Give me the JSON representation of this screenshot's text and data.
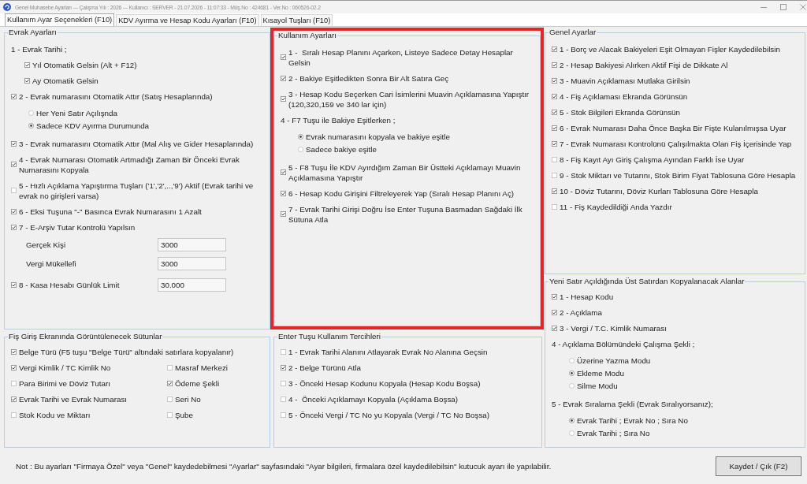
{
  "window": {
    "title": "Genel Muhasebe Ayarları --- Çalışma Yılı : 2026 --- Kullanıcı : SERVER - 21.07.2026 - 11:07:33 - Müş.No : 424681 - Ver.No : 060526-02.2"
  },
  "tabs": [
    {
      "label": "Kullanım Ayar Seçenekleri (F10)",
      "selected": true
    },
    {
      "label": "KDV Ayırma ve Hesap Kodu Ayarları (F10)",
      "selected": false
    },
    {
      "label": "Kısayol Tuşları (F10)",
      "selected": false
    }
  ],
  "columns": [
    {
      "panels": [
        {
          "title": "Evrak Ayarları",
          "highlighted": false,
          "items": [
            {
              "kind": "heading",
              "label": "1 - Evrak Tarihi ;",
              "children": [
                {
                  "kind": "check",
                  "label": "Yıl Otomatik Gelsin (Alt + F12)",
                  "checked": true
                },
                {
                  "kind": "check",
                  "label": "Ay Otomatik Gelsin",
                  "checked": true
                }
              ]
            },
            {
              "kind": "check",
              "label": "2 - Evrak numarasını Otomatik Attır (Satış Hesaplarında)",
              "checked": true,
              "children": [
                {
                  "kind": "radio",
                  "label": "Her Yeni Satır Açılışnda",
                  "selected": false
                },
                {
                  "kind": "radio",
                  "label": "Sadece KDV Ayırma Durumunda",
                  "selected": true
                }
              ]
            },
            {
              "kind": "check",
              "label": "3 - Evrak numarasını Otomatik Attır (Mal Alış ve Gider Hesaplarında)",
              "checked": true
            },
            {
              "kind": "check",
              "label": "4 - Evrak Numarası Otomatik Artmadığı Zaman Bir Önceki Evrak Numarasını Kopyala",
              "checked": true
            },
            {
              "kind": "check",
              "label": "5 - Hızlı Açıklama Yapıştırma Tuşları ('1','2',..,'9') Aktif (Evrak tarihi ve evrak no girişleri varsa)",
              "checked": false
            },
            {
              "kind": "check",
              "label": "6 - Eksi Tuşuna \"-\" Basınca Evrak Numarasını 1 Azalt",
              "checked": true
            },
            {
              "kind": "check",
              "label": "7 - E-Arşiv Tutar Kontrolü Yapılsın",
              "checked": true,
              "children": [
                {
                  "kind": "field",
                  "label": "Gerçek Kişi",
                  "value": "3000"
                },
                {
                  "kind": "field",
                  "label": "Vergi Mükellefi",
                  "value": "3000"
                }
              ]
            },
            {
              "kind": "check",
              "label": "8 - Kasa Hesabı Günlük Limit",
              "checked": true,
              "value": "30.000"
            }
          ]
        },
        {
          "title": "Fiş Giriş Ekranında Görüntülenecek Sütunlar",
          "highlighted": false,
          "rows": [
            [
              {
                "kind": "check",
                "label": "Belge Türü (F5 tuşu \"Belge Türü\" altındaki satırlara kopyalanır)",
                "checked": true
              }
            ],
            [
              {
                "kind": "check",
                "label": "Vergi Kimlik / TC Kimlik No",
                "checked": true
              },
              {
                "kind": "check",
                "label": "Masraf Merkezi",
                "checked": false
              }
            ],
            [
              {
                "kind": "check",
                "label": "Para Birimi ve Döviz Tutarı",
                "checked": false
              },
              {
                "kind": "check",
                "label": "Ödeme Şekli",
                "checked": true
              }
            ],
            [
              {
                "kind": "check",
                "label": "Evrak Tarihi ve Evrak Numarası",
                "checked": true
              },
              {
                "kind": "check",
                "label": "Seri No",
                "checked": false
              }
            ],
            [
              {
                "kind": "check",
                "label": "Stok Kodu ve Miktarı",
                "checked": false
              },
              {
                "kind": "check",
                "label": "Şube",
                "checked": false
              }
            ]
          ]
        }
      ]
    },
    {
      "panels": [
        {
          "title": "Kullanım Ayarları",
          "highlighted": true,
          "items": [
            {
              "kind": "check",
              "label": "1 -  Sıralı Hesap Planını Açarken, Listeye Sadece Detay Hesaplar Gelsin",
              "checked": true
            },
            {
              "kind": "check",
              "label": "2 - Bakiye Eşitledikten Sonra Bir Alt Satıra Geç",
              "checked": true
            },
            {
              "kind": "check",
              "label": "3 - Hesap Kodu Seçerken Cari İsimlerini Muavin Açıklamasına Yapıştır (120,320,159 ve 340 lar için)",
              "checked": true
            },
            {
              "kind": "heading",
              "label": "4 - F7 Tuşu ile Bakiye Eşitlerken ;",
              "children": [
                {
                  "kind": "radio",
                  "label": "Evrak numarasını kopyala ve bakiye eşitle",
                  "selected": true
                },
                {
                  "kind": "radio",
                  "label": "Sadece bakiye eşitle",
                  "selected": false
                }
              ]
            },
            {
              "kind": "check",
              "label": "5 - F8 Tuşu İle KDV Ayırdığım Zaman Bir Üstteki Açıklamayı Muavin Açıklamasına Yapıştır",
              "checked": true
            },
            {
              "kind": "check",
              "label": "6 - Hesap Kodu Girişini Filtreleyerek Yap (Sıralı Hesap Planını Aç)",
              "checked": true
            },
            {
              "kind": "check",
              "label": "7 - Evrak Tarihi Girişi Doğru İse Enter Tuşuna Basmadan Sağdaki İlk Sütuna Atla",
              "checked": true
            }
          ]
        },
        {
          "title": "Enter Tuşu Kullanım Tercihleri",
          "highlighted": false,
          "items": [
            {
              "kind": "check",
              "label": "1 - Evrak Tarihi Alanını Atlayarak Evrak No Alanına Geçsin",
              "checked": false
            },
            {
              "kind": "check",
              "label": "2 - Belge Türünü Atla",
              "checked": true
            },
            {
              "kind": "check",
              "label": "3 - Önceki Hesap Kodunu Kopyala (Hesap Kodu Boşsa)",
              "checked": false
            },
            {
              "kind": "check",
              "label": "4 -  Önceki Açıklamayı Kopyala (Açıklama Boşsa)",
              "checked": false
            },
            {
              "kind": "check",
              "label": "5 - Önceki Vergi / TC No yu Kopyala (Vergi / TC No Boşsa)",
              "checked": false
            }
          ]
        }
      ]
    },
    {
      "panels": [
        {
          "title": "Genel Ayarlar",
          "highlighted": false,
          "items": [
            {
              "kind": "check",
              "label": "1 - Borç ve Alacak Bakiyeleri Eşit Olmayan Fişler Kaydedilebilsin",
              "checked": true
            },
            {
              "kind": "check",
              "label": "2 - Hesap Bakiyesi Alırken Aktif Fişi de Dikkate Al",
              "checked": true
            },
            {
              "kind": "check",
              "label": "3 - Muavin Açıklaması Mutlaka Girilsin",
              "checked": true
            },
            {
              "kind": "check",
              "label": "4 - Fiş Açıklaması Ekranda Görünsün",
              "checked": true
            },
            {
              "kind": "check",
              "label": "5 - Stok Bilgileri Ekranda Görünsün",
              "checked": true
            },
            {
              "kind": "check",
              "label": "6 - Evrak Numarası Daha Önce Başka Bir Fişte Kulanılmışsa Uyar",
              "checked": true
            },
            {
              "kind": "check",
              "label": "7 - Evrak Numarası Kontrolünü Çalışılmakta Olan Fiş İçerisinde Yap",
              "checked": true
            },
            {
              "kind": "check",
              "label": "8 - Fiş Kayıt Ayı Giriş Çalışma Ayından Farklı İse Uyar",
              "checked": false
            },
            {
              "kind": "check",
              "label": "9 - Stok Miktarı ve Tutarını, Stok Birim Fiyat Tablosuna Göre Hesapla",
              "checked": false
            },
            {
              "kind": "check",
              "label": "10 - Döviz Tutarını, Döviz Kurları Tablosuna Göre Hesapla",
              "checked": true
            },
            {
              "kind": "check",
              "label": "11 - Fiş Kaydedildiği Anda Yazdır",
              "checked": false
            }
          ]
        },
        {
          "title": "Yeni Satır Açıldığında Üst Satırdan Kopyalanacak Alanlar",
          "highlighted": false,
          "items": [
            {
              "kind": "check",
              "label": "1 - Hesap Kodu",
              "checked": true
            },
            {
              "kind": "check",
              "label": "2 - Açıklama",
              "checked": true
            },
            {
              "kind": "check",
              "label": "3 - Vergi / T.C. Kimlik Numarası",
              "checked": true
            },
            {
              "kind": "heading",
              "label": "4 - Açıklama Bölümündeki Çalışma Şekli ;",
              "children": [
                {
                  "kind": "radio",
                  "label": "Üzerine Yazma Modu",
                  "selected": false
                },
                {
                  "kind": "radio",
                  "label": "Ekleme Modu",
                  "selected": true
                },
                {
                  "kind": "radio",
                  "label": "Silme Modu",
                  "selected": false
                }
              ]
            },
            {
              "kind": "heading",
              "label": "5 - Evrak Sıralama Şekli (Evrak Sıralıyorsanız);",
              "children": [
                {
                  "kind": "radio",
                  "label": "Evrak Tarihi ; Evrak No ; Sıra No",
                  "selected": true
                },
                {
                  "kind": "radio",
                  "label": "Evrak Tarihi ; Sıra No",
                  "selected": false
                }
              ]
            }
          ]
        }
      ]
    }
  ],
  "note": "Not : Bu ayarları \"Firmaya Özel\" veya \"Genel\" kaydedebilmesi \"Ayarlar\" sayfasındaki \"Ayar bilgileri, firmalara özel kaydedilebilsin\" kutucuk ayarı ile yapılabilir.",
  "buttons": [
    {
      "label": "Kaydet / Çık (F2)"
    }
  ]
}
